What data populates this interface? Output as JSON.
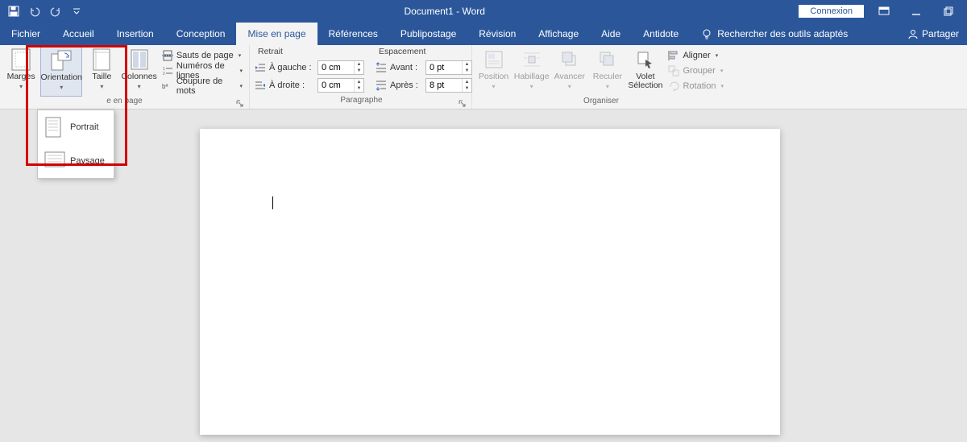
{
  "titlebar": {
    "title": "Document1  -  Word",
    "connexion": "Connexion"
  },
  "tabs": {
    "fichier": "Fichier",
    "accueil": "Accueil",
    "insertion": "Insertion",
    "conception": "Conception",
    "mise_en_page": "Mise en page",
    "references": "Références",
    "publipostage": "Publipostage",
    "revision": "Révision",
    "affichage": "Affichage",
    "aide": "Aide",
    "antidote": "Antidote",
    "tell_me": "Rechercher des outils adaptés",
    "partager": "Partager"
  },
  "ribbon": {
    "group_mise_en_page": {
      "label": "e en page",
      "marges": "Marges",
      "orientation": "Orientation",
      "taille": "Taille",
      "colonnes": "Colonnes",
      "sauts": "Sauts de page",
      "numeros": "Numéros de lignes",
      "coupure": "Coupure de mots"
    },
    "group_paragraphe": {
      "label": "Paragraphe",
      "retrait": "Retrait",
      "espacement": "Espacement",
      "a_gauche": "À gauche :",
      "a_droite": "À droite :",
      "avant": "Avant :",
      "apres": "Après :",
      "val_gauche": "0 cm",
      "val_droite": "0 cm",
      "val_avant": "0 pt",
      "val_apres": "8 pt"
    },
    "group_organiser": {
      "label": "Organiser",
      "position": "Position",
      "habillage": "Habillage",
      "avancer": "Avancer",
      "reculer": "Reculer",
      "volet_selection_1": "Volet",
      "volet_selection_2": "Sélection",
      "aligner": "Aligner",
      "grouper": "Grouper",
      "rotation": "Rotation"
    }
  },
  "orientation_menu": {
    "portrait": "Portrait",
    "paysage": "Paysage"
  }
}
